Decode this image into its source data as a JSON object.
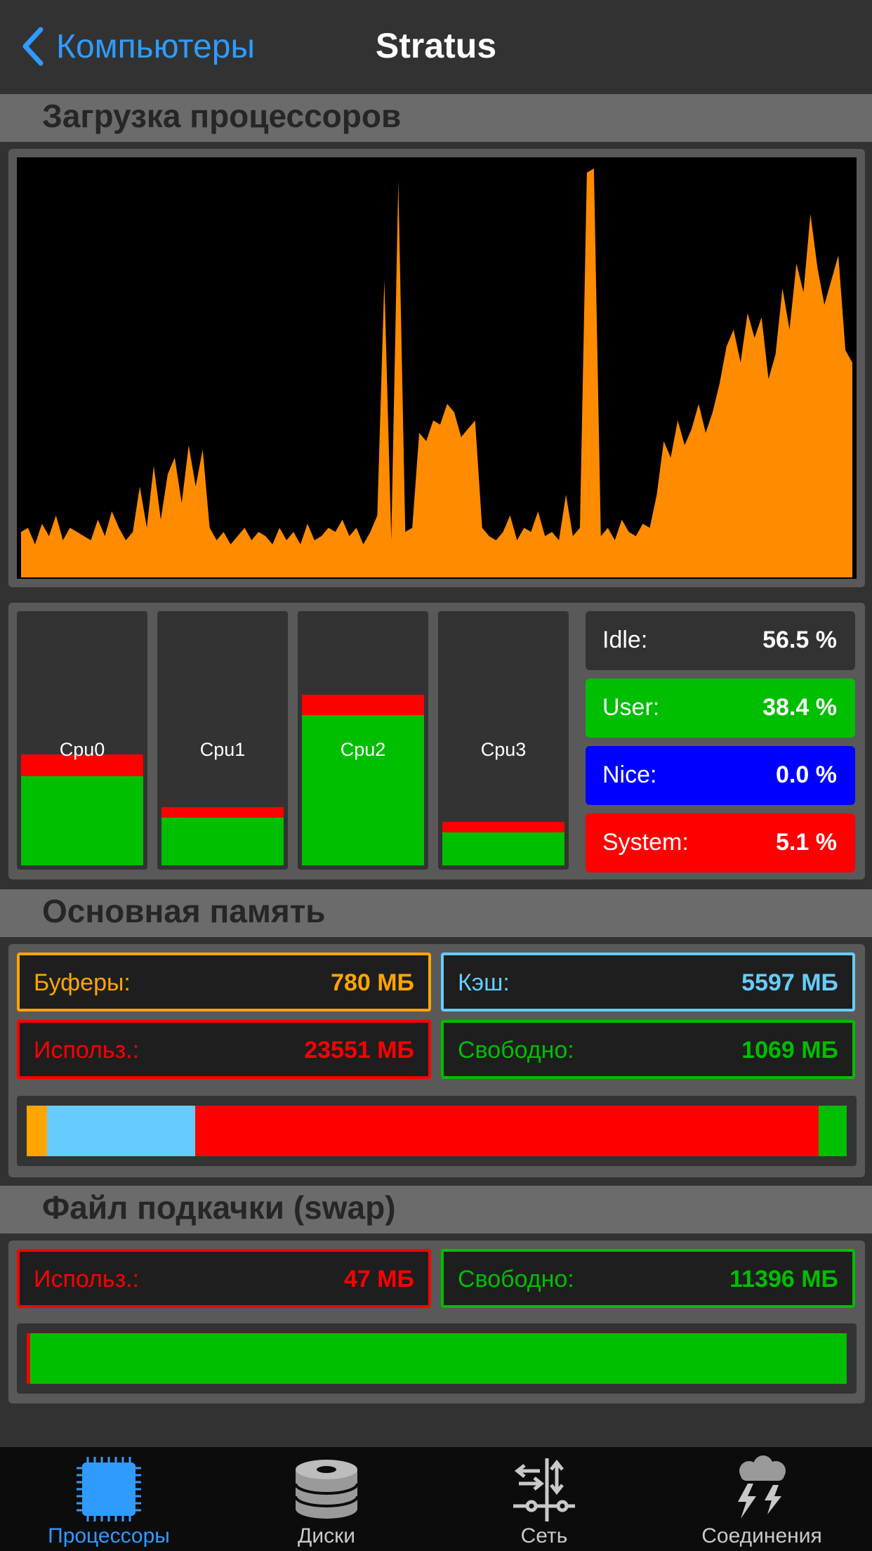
{
  "nav": {
    "back_label": "Компьютеры",
    "title": "Stratus"
  },
  "cpu_section": {
    "title": "Загрузка процессоров",
    "chart_color": "#ff8c00",
    "chart_data": {
      "type": "area",
      "title": "",
      "xlabel": "",
      "ylabel": "",
      "ylim": [
        0,
        100
      ],
      "series": [
        {
          "values": [
            11,
            12,
            8,
            13,
            10,
            15,
            9,
            12,
            11,
            10,
            9,
            14,
            10,
            16,
            12,
            9,
            11,
            22,
            12,
            27,
            14,
            25,
            29,
            18,
            32,
            22,
            31,
            12,
            9,
            11,
            8,
            10,
            12,
            9,
            11,
            10,
            8,
            12,
            9,
            11,
            8,
            13,
            9,
            10,
            12,
            11,
            14,
            10,
            12,
            8,
            11,
            15,
            72,
            9,
            96,
            11,
            12,
            35,
            33,
            38,
            37,
            42,
            40,
            34,
            36,
            38,
            12,
            10,
            9,
            11,
            15,
            9,
            12,
            11,
            16,
            10,
            11,
            9,
            20,
            10,
            12,
            98,
            99,
            10,
            12,
            9,
            14,
            11,
            10,
            13,
            12,
            20,
            33,
            29,
            38,
            32,
            36,
            42,
            35,
            40,
            47,
            56,
            60,
            52,
            64,
            58,
            63,
            48,
            54,
            70,
            60,
            76,
            69,
            88,
            75,
            66,
            72,
            78,
            55,
            52
          ]
        }
      ]
    },
    "cpus": [
      {
        "name": "Cpu0",
        "total": 44.5,
        "system": 8.7
      },
      {
        "name": "Cpu1",
        "total": 23.3,
        "system": 4.3
      },
      {
        "name": "Cpu2",
        "total": 68.3,
        "system": 8.3
      },
      {
        "name": "Cpu3",
        "total": 17.4,
        "system": 4.3
      }
    ],
    "stats": {
      "idle": {
        "label": "Idle:",
        "value": "56.5 %",
        "color": "#323232"
      },
      "user": {
        "label": "User:",
        "value": "38.4 %",
        "color": "#00be00"
      },
      "nice": {
        "label": "Nice:",
        "value": "0.0 %",
        "color": "#0000ff"
      },
      "system": {
        "label": "System:",
        "value": "5.1 %",
        "color": "#ff0000"
      }
    }
  },
  "memory_section": {
    "title": "Основная память",
    "buffers": {
      "label": "Буферы:",
      "value": "780 МБ",
      "color": "#ffa500"
    },
    "cache": {
      "label": "Кэш:",
      "value": "5597 МБ",
      "color": "#66ccff"
    },
    "used": {
      "label": "Использ.:",
      "value": "23551 МБ",
      "color": "#ff0000"
    },
    "free": {
      "label": "Свободно:",
      "value": "1069 МБ",
      "color": "#00be00"
    },
    "bar_mb": {
      "buffers": 780,
      "cache": 5597,
      "used": 23551,
      "free": 1069
    }
  },
  "swap_section": {
    "title": "Файл подкачки (swap)",
    "used": {
      "label": "Использ.:",
      "value": "47 МБ",
      "color": "#ff0000"
    },
    "free": {
      "label": "Свободно:",
      "value": "11396 МБ",
      "color": "#00be00"
    },
    "bar_mb": {
      "used": 47,
      "free": 11396
    }
  },
  "tabs": [
    {
      "label": "Процессоры",
      "icon": "cpu-chip-icon",
      "active": true,
      "color": "#2f9bff"
    },
    {
      "label": "Диски",
      "icon": "disk-stack-icon",
      "active": false,
      "color": "#c9c9c9"
    },
    {
      "label": "Сеть",
      "icon": "network-icon",
      "active": false,
      "color": "#c9c9c9"
    },
    {
      "label": "Соединения",
      "icon": "cloud-lightning-icon",
      "active": false,
      "color": "#c9c9c9"
    }
  ]
}
